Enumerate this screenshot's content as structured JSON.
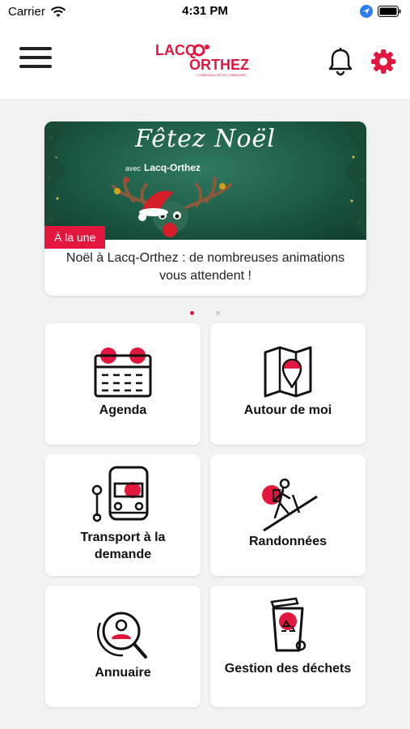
{
  "status_bar": {
    "carrier": "Carrier",
    "time": "4:31 PM"
  },
  "header": {
    "logo_line1": "LACQ",
    "logo_line2": "ORTHEZ",
    "logo_tagline": "COMMUNAUTÉ DE COMMUNES"
  },
  "carousel": {
    "image_title": "Fêtez Noël",
    "image_subtitle_small": "avec",
    "image_subtitle": "Lacq-Orthez",
    "badge": "À la une",
    "caption": "Noël à Lacq-Orthez : de nombreuses animations vous attendent !",
    "active_index": 0,
    "count": 2
  },
  "tiles": [
    {
      "label": "Agenda",
      "icon": "calendar-icon"
    },
    {
      "label": "Autour de moi",
      "icon": "map-pin-icon"
    },
    {
      "label": "Transport à la demande",
      "icon": "bus-stop-icon"
    },
    {
      "label": "Randonnées",
      "icon": "hiker-icon"
    },
    {
      "label": "Annuaire",
      "icon": "person-search-icon"
    },
    {
      "label": "Gestion des déchets",
      "icon": "recycle-bin-icon"
    }
  ],
  "colors": {
    "accent": "#e3173e",
    "text": "#111111",
    "background": "#f2f2f2"
  }
}
